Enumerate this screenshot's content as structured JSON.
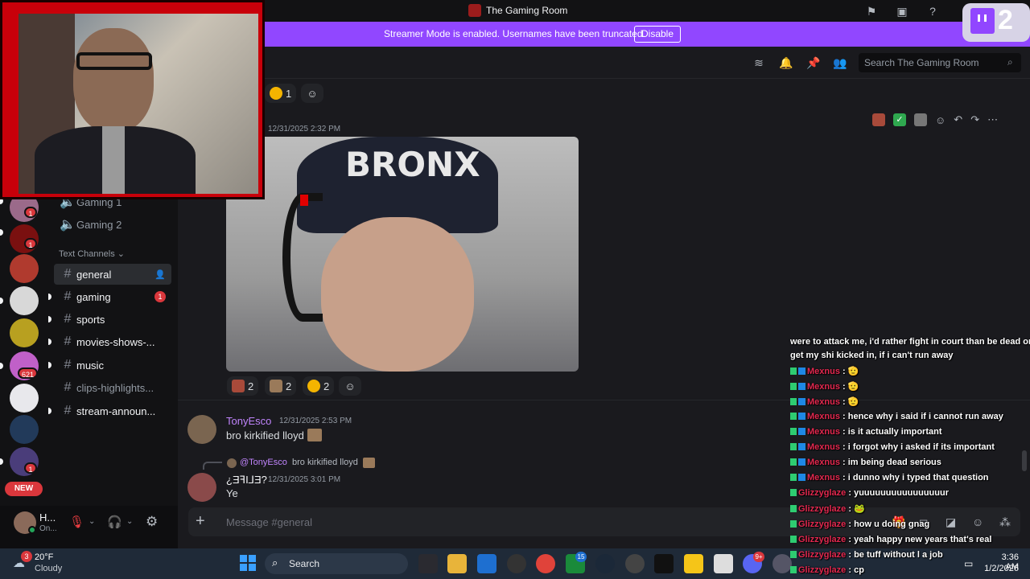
{
  "window": {
    "title": "The Gaming Room"
  },
  "banner": {
    "message": "Streamer Mode is enabled. Usernames have been truncated.",
    "button": "Disable"
  },
  "header": {
    "search_placeholder": "Search The Gaming Room"
  },
  "servers": [
    {
      "badge": "1"
    },
    {
      "badge": "1"
    },
    {
      "badge": ""
    },
    {
      "badge": ""
    },
    {
      "badge": ""
    },
    {
      "badge": "621"
    },
    {
      "badge": ""
    },
    {
      "badge": ""
    },
    {
      "badge": "1"
    }
  ],
  "servers_new_label": "NEW",
  "channels": {
    "voice": [
      {
        "name": "Gaming 1"
      },
      {
        "name": "Gaming 2"
      }
    ],
    "text_header": "Text Channels",
    "text": [
      {
        "name": "general",
        "active": true,
        "badge": ""
      },
      {
        "name": "gaming",
        "active": false,
        "badge": "1"
      },
      {
        "name": "sports",
        "active": false,
        "badge": ""
      },
      {
        "name": "movies-shows-...",
        "active": false,
        "badge": ""
      },
      {
        "name": "music",
        "active": false,
        "badge": ""
      },
      {
        "name": "clips-highlights...",
        "active": false,
        "badge": ""
      },
      {
        "name": "stream-announ...",
        "active": false,
        "badge": ""
      }
    ]
  },
  "user": {
    "name": "H...",
    "status": "On..."
  },
  "messages": {
    "top_reactions": [
      {
        "count": "1"
      }
    ],
    "image_post": {
      "timestamp": "12/31/2025 2:32 PM",
      "overlay_text": "BRONX"
    },
    "image_reactions": [
      {
        "count": "2"
      },
      {
        "count": "2"
      },
      {
        "count": "2"
      }
    ],
    "msg1": {
      "author": "TonyEsco",
      "timestamp": "12/31/2025 2:53 PM",
      "text": "bro kirkified lloyd"
    },
    "reply": {
      "mention": "@TonyEsco",
      "quoted": "bro kirkified lloyd"
    },
    "msg2": {
      "author": "¿ƎꟻI⅃Ǝ?",
      "timestamp": "12/31/2025 3:01 PM",
      "text": "Ye"
    }
  },
  "composer": {
    "placeholder": "Message #general"
  },
  "twitch": {
    "count": "2"
  },
  "twitch_chat": [
    {
      "name": "",
      "text": "were to attack me, i'd rather fight in court than be dead or"
    },
    {
      "name": "",
      "text": "get my shi kicked in, if i can't run away"
    },
    {
      "name": "Mexnus",
      "text": ": 🫡"
    },
    {
      "name": "Mexnus",
      "text": ": 🫡"
    },
    {
      "name": "Mexnus",
      "text": ": 🫡"
    },
    {
      "name": "Mexnus",
      "text": ": hence why i said if i cannot run away"
    },
    {
      "name": "Mexnus",
      "text": ": is it actually important"
    },
    {
      "name": "Mexnus",
      "text": ": i forgot why i asked if its important"
    },
    {
      "name": "Mexnus",
      "text": ": im being dead serious"
    },
    {
      "name": "Mexnus",
      "text": ": i dunno why i typed that question"
    },
    {
      "name": "Glizzyglaze",
      "text": ": yuuuuuuuuuuuuuuuur"
    },
    {
      "name": "Glizzyglaze",
      "text": ": 🐸"
    },
    {
      "name": "Glizzyglaze",
      "text": ": how u doing gnag"
    },
    {
      "name": "Glizzyglaze",
      "text": ": yeah happy new years that's real"
    },
    {
      "name": "Glizzyglaze",
      "text": ": be tuff without l a job"
    },
    {
      "name": "Glizzyglaze",
      "text": ": cp"
    }
  ],
  "taskbar": {
    "weather_temp": "20°F",
    "weather_desc": "Cloudy",
    "weather_badge": "3",
    "search": "Search",
    "time": "3:36 AM",
    "date": "1/2/2026",
    "xbox_badge": "15",
    "discord_badge": "9+"
  },
  "colors": {
    "accent": "#9147ff",
    "mention": "#c084fc",
    "chat_name": "#e3284f"
  }
}
